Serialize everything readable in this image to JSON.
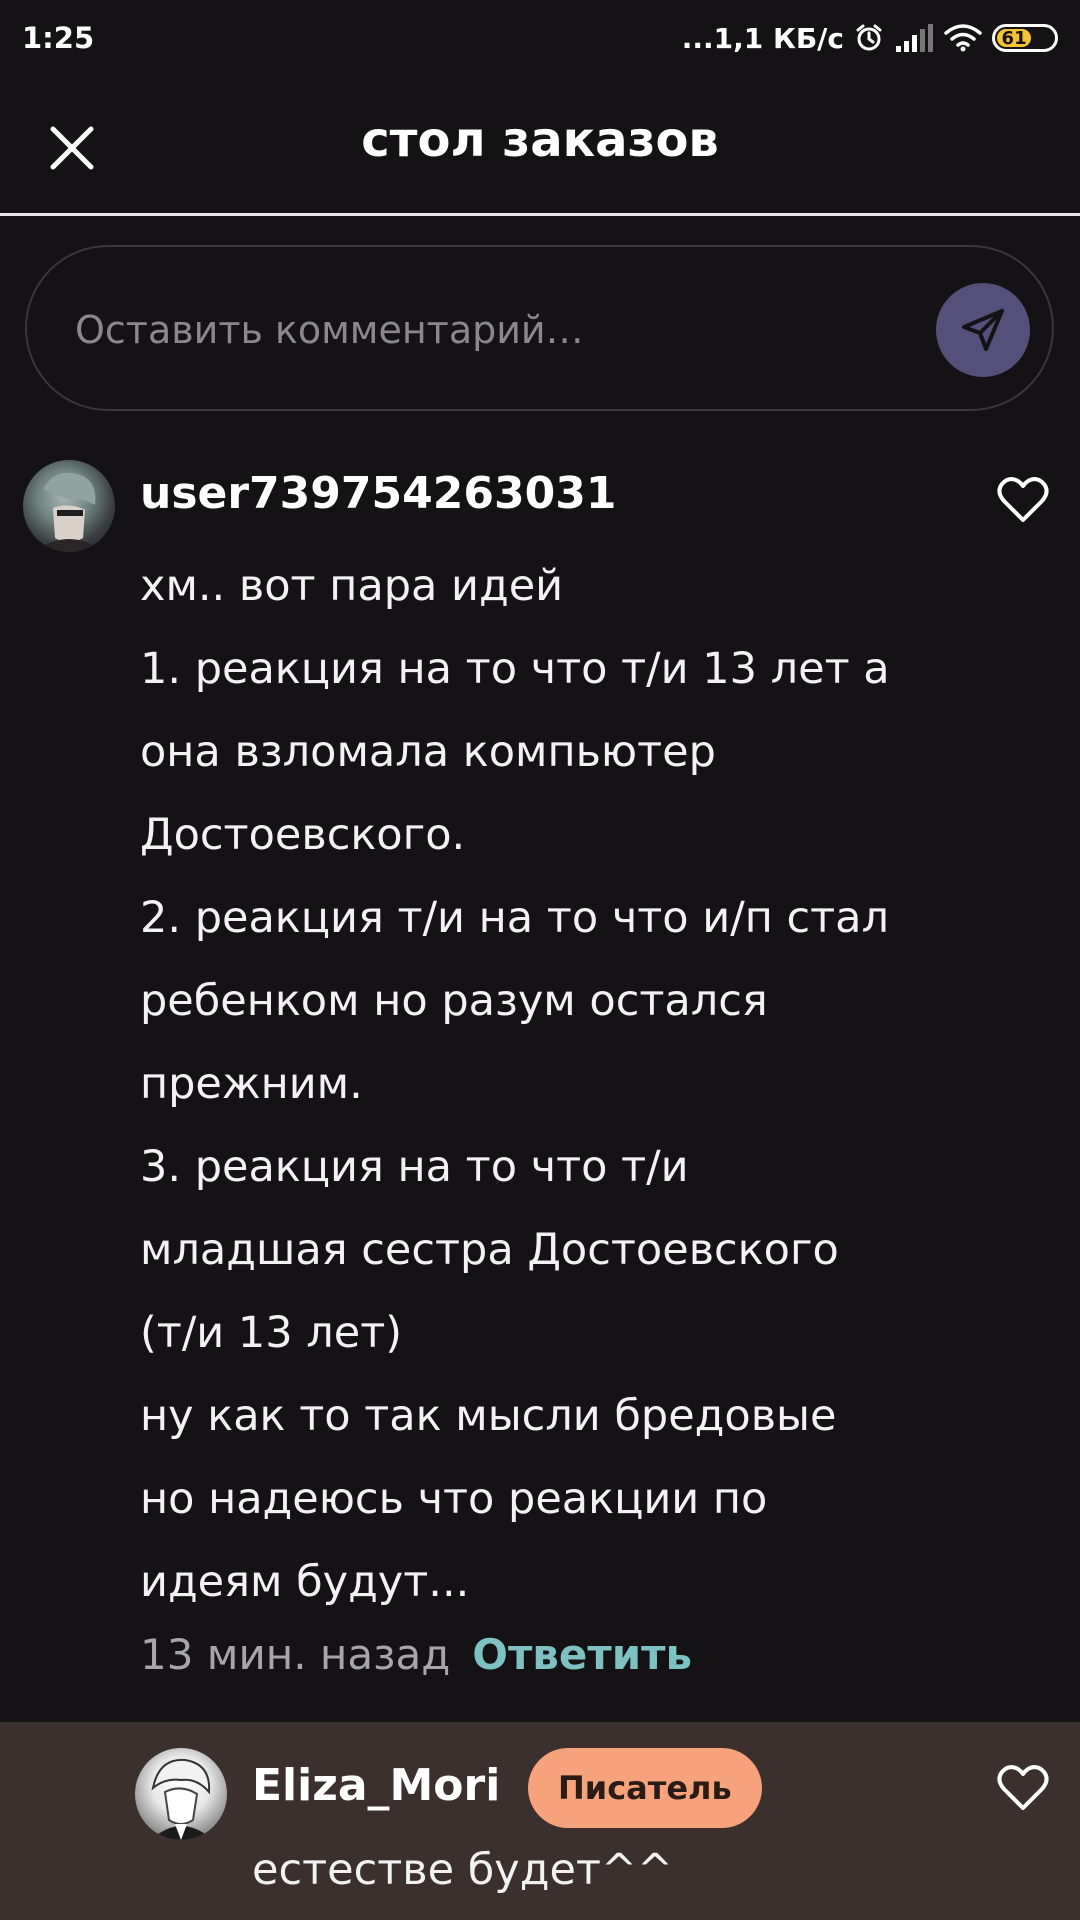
{
  "status_bar": {
    "time": "1:25",
    "network_speed": "...1,1 КБ/с",
    "battery": "61",
    "icons": [
      "alarm-icon",
      "signal-icon",
      "wifi-icon",
      "battery-icon"
    ]
  },
  "header": {
    "title": "стол заказов",
    "close_icon": "close-icon"
  },
  "comment_input": {
    "placeholder": "Оставить комментарий…",
    "send_icon": "send-icon"
  },
  "comment": {
    "username": "user739754263031",
    "text": "хм.. вот пара идей\n1. реакция на то что т/и 13 лет а\nона взломала компьютер\nДостоевского.\n2. реакция т/и на то что и/п стал\nребенком но разум остался\nпрежним.\n3. реакция на то что т/и\nмладшая сестра Достоевского\n(т/и 13 лет)\nну как то так мысли бредовые\nно надеюсь что реакции по\nидеям будут...",
    "time_ago": "13 мин. назад",
    "reply_label": "Ответить",
    "like_icon": "heart-outline-icon"
  },
  "reply": {
    "username": "Eliza_Mori",
    "badge": "Писатель",
    "text": "естестве будет^^",
    "like_icon": "heart-outline-icon"
  },
  "colors": {
    "background": "#141215",
    "send_button": "#55507a",
    "reply_link": "#7ec1c2",
    "reply_band": "#3b302e",
    "writer_badge": "#f6a27c"
  }
}
